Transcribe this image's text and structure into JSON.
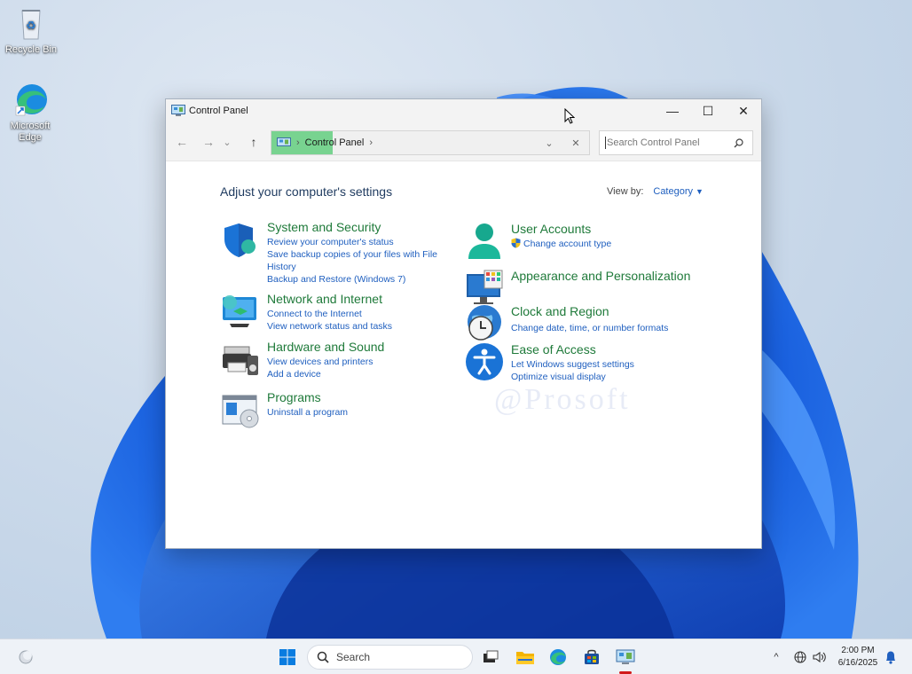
{
  "desktop": {
    "icons": [
      {
        "label": "Recycle Bin",
        "icon": "recycle-bin-icon"
      },
      {
        "label": "Microsoft Edge",
        "icon": "edge-icon"
      }
    ]
  },
  "window": {
    "title": "Control Panel",
    "controls": {
      "minimize": "—",
      "maximize": "☐",
      "close": "✕"
    }
  },
  "navbar": {
    "back": "←",
    "forward": "→",
    "recent": "⌄",
    "up": "↑",
    "address": {
      "crumbs": [
        "Control Panel"
      ],
      "separator": "›",
      "dropdown": "⌄",
      "clear": "✕"
    },
    "search": {
      "placeholder": "Search Control Panel"
    }
  },
  "content": {
    "heading": "Adjust your computer's settings",
    "view_by": {
      "label": "View by:",
      "value": "Category",
      "caret": "▼"
    },
    "categories_left": [
      {
        "title": "System and Security",
        "icon": "shield-security-icon",
        "links": [
          "Review your computer's status",
          "Save backup copies of your files with File History",
          "Backup and Restore (Windows 7)"
        ]
      },
      {
        "title": "Network and Internet",
        "icon": "network-globe-icon",
        "links": [
          "Connect to the Internet",
          "View network status and tasks"
        ]
      },
      {
        "title": "Hardware and Sound",
        "icon": "printer-speaker-icon",
        "links": [
          "View devices and printers",
          "Add a device"
        ]
      },
      {
        "title": "Programs",
        "icon": "programs-disc-icon",
        "links": [
          "Uninstall a program"
        ]
      }
    ],
    "categories_right": [
      {
        "title": "User Accounts",
        "icon": "user-accounts-icon",
        "links": [
          "Change account type"
        ]
      },
      {
        "title": "Appearance and Personalization",
        "icon": "monitor-personalize-icon",
        "links": []
      },
      {
        "title": "Clock and Region",
        "icon": "clock-globe-icon",
        "links": [
          "Change date, time, or number formats"
        ]
      },
      {
        "title": "Ease of Access",
        "icon": "accessibility-icon",
        "links": [
          "Let Windows suggest settings",
          "Optimize visual display"
        ]
      }
    ],
    "watermark": "@Prosoft"
  },
  "taskbar": {
    "search_label": "Search",
    "clock_time": "2:00 PM",
    "clock_date": "6/16/2025",
    "tray_chevron": "^",
    "colors": {
      "accent": "#0067c0",
      "link": "#1f5fbf",
      "category": "#1f7a3a"
    }
  }
}
